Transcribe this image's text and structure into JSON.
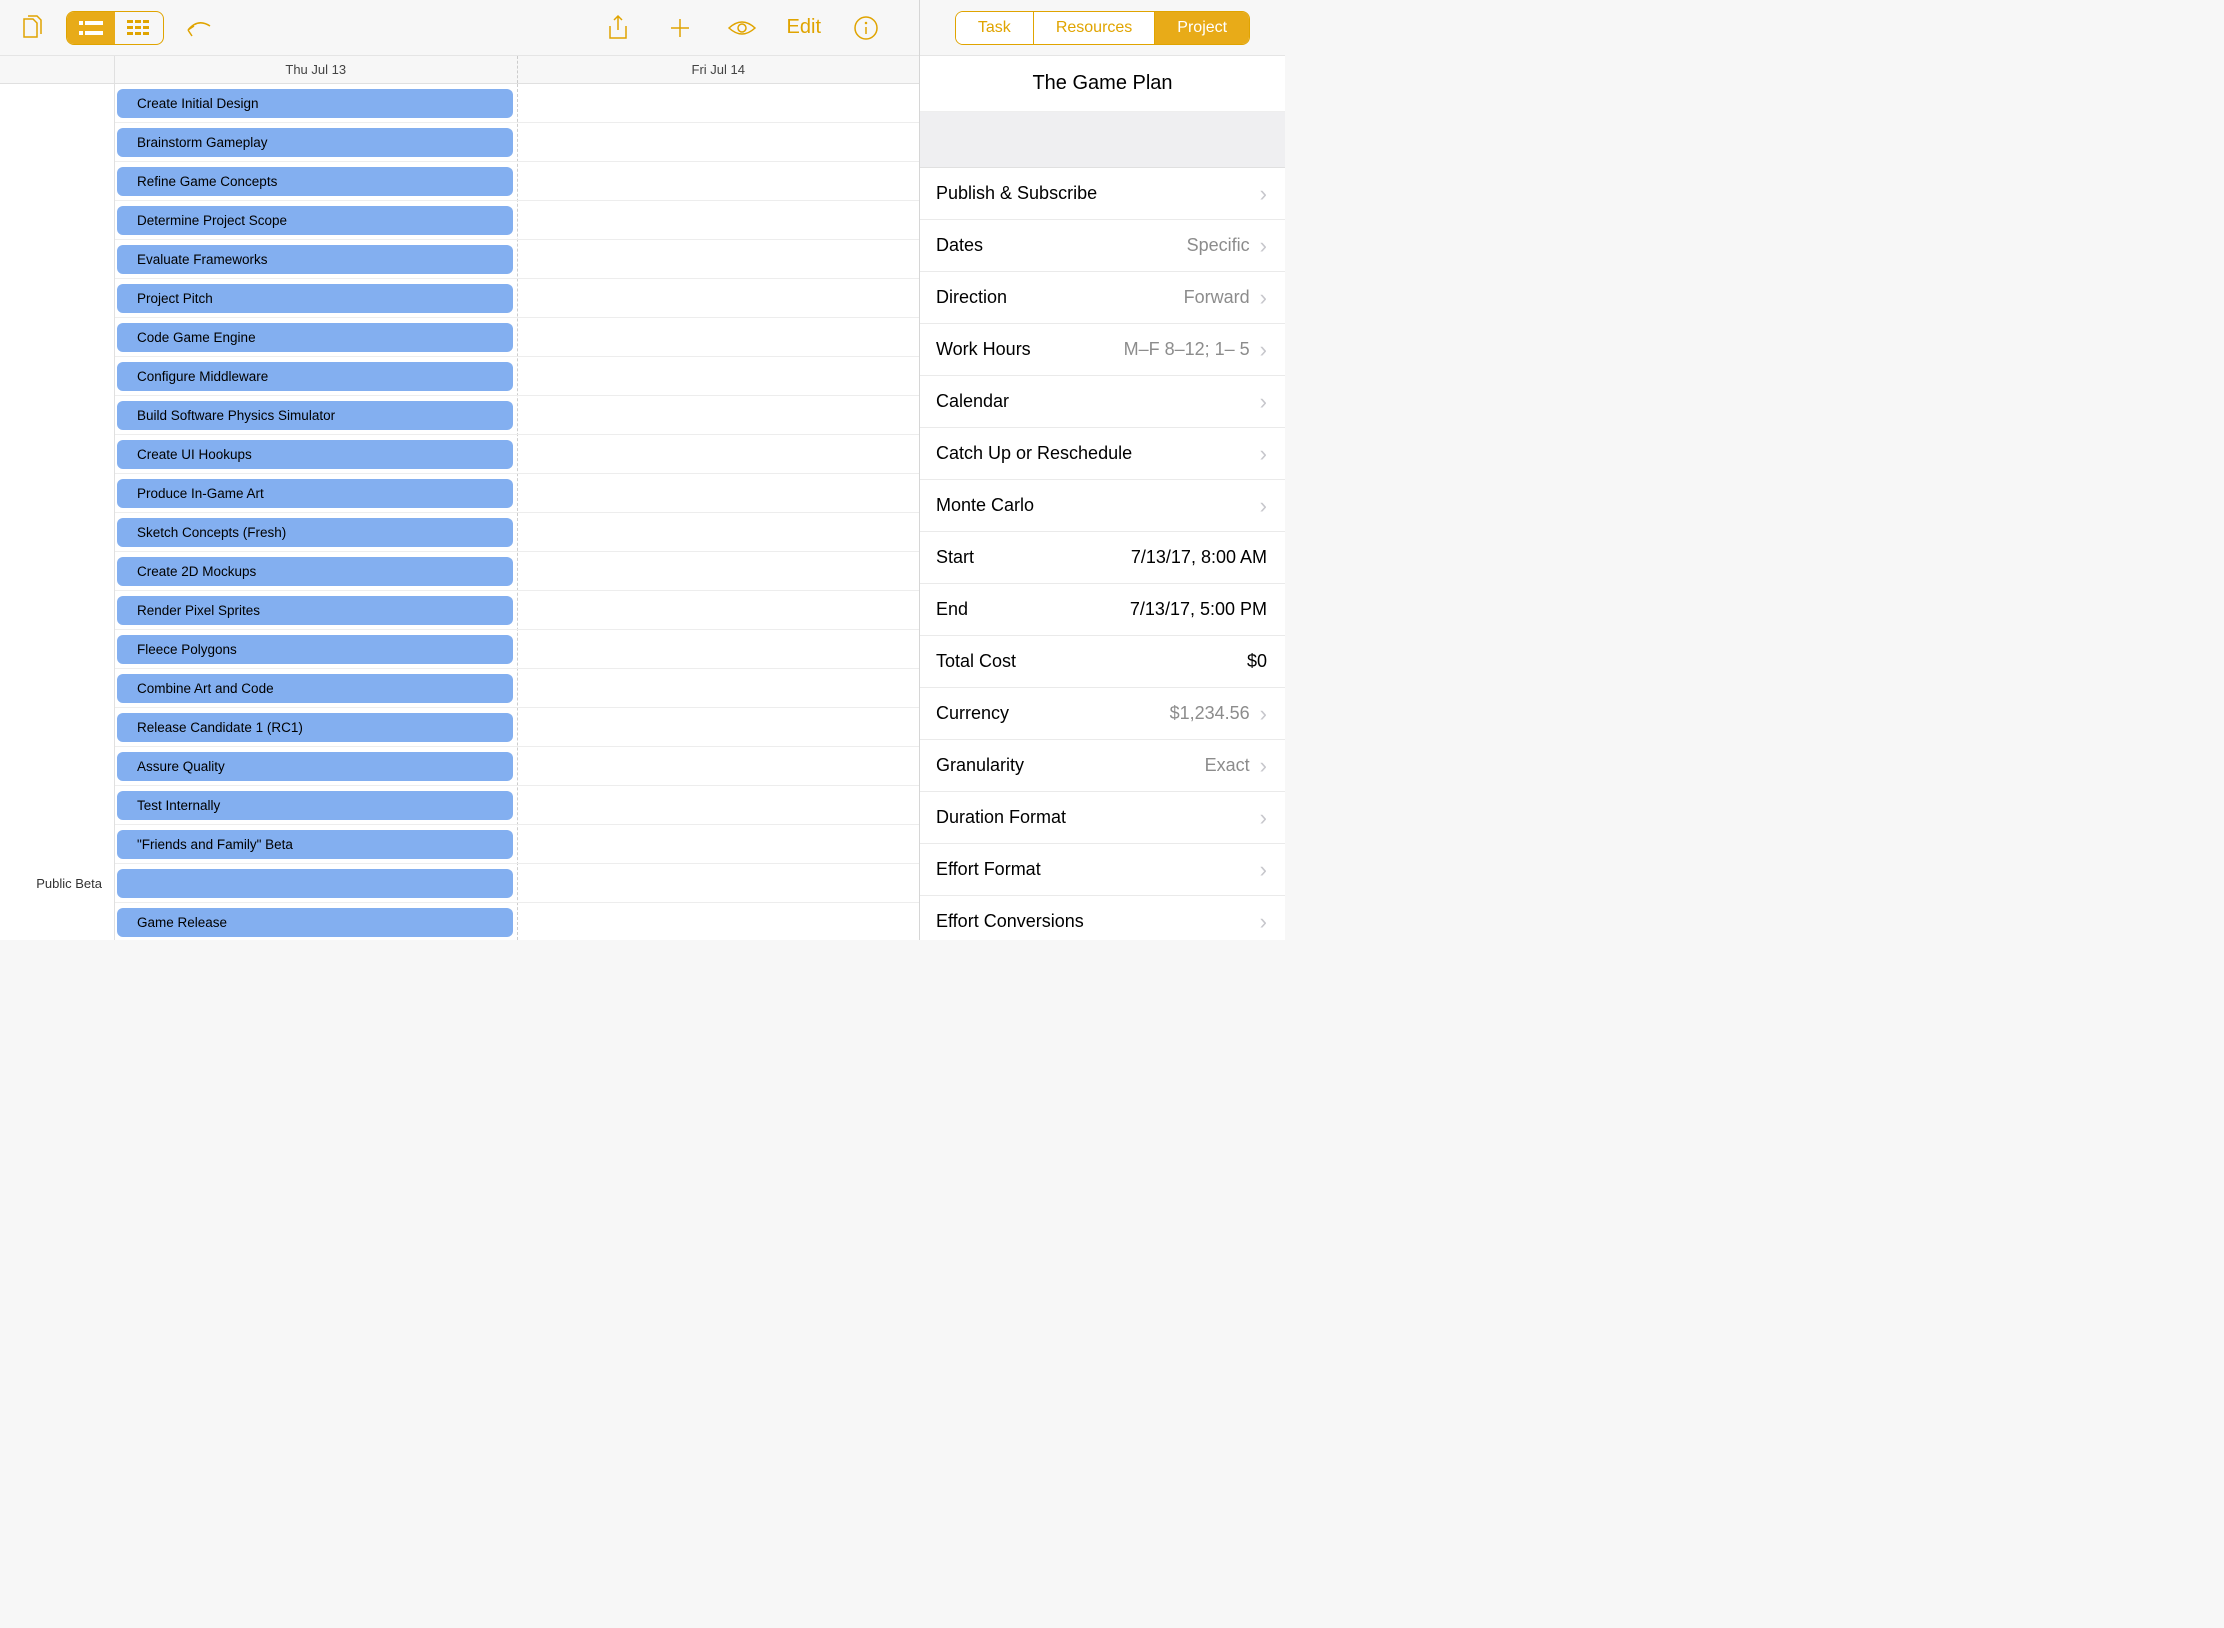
{
  "toolbar": {
    "edit_label": "Edit"
  },
  "timeline": {
    "days": [
      "Thu Jul 13",
      "Fri Jul 14"
    ],
    "row_labels": [
      "",
      "",
      "",
      "",
      "",
      "",
      "",
      "",
      "",
      "",
      "",
      "",
      "",
      "",
      "",
      "",
      "",
      "",
      "",
      "",
      "Public Beta",
      ""
    ],
    "tasks": [
      "Create Initial Design",
      "Brainstorm Gameplay",
      "Refine Game Concepts",
      "Determine Project Scope",
      "Evaluate Frameworks",
      "Project Pitch",
      "Code Game Engine",
      "Configure Middleware",
      "Build Software Physics Simulator",
      "Create UI Hookups",
      "Produce In-Game Art",
      "Sketch Concepts (Fresh)",
      "Create 2D Mockups",
      "Render Pixel Sprites",
      "Fleece Polygons",
      "Combine Art and Code",
      "Release Candidate 1 (RC1)",
      "Assure Quality",
      "Test Internally",
      "\"Friends and Family\" Beta",
      "",
      "Game Release"
    ]
  },
  "inspector": {
    "tabs": {
      "task": "Task",
      "resources": "Resources",
      "project": "Project"
    },
    "title": "The Game Plan",
    "rows": {
      "publish": "Publish & Subscribe",
      "dates": {
        "label": "Dates",
        "value": "Specific"
      },
      "direction": {
        "label": "Direction",
        "value": "Forward"
      },
      "workhours": {
        "label": "Work Hours",
        "value": "M–F  8–12; 1– 5"
      },
      "calendar": "Calendar",
      "catchup": "Catch Up or Reschedule",
      "montecarlo": "Monte Carlo",
      "start": {
        "label": "Start",
        "value": "7/13/17, 8:00 AM"
      },
      "end": {
        "label": "End",
        "value": "7/13/17, 5:00 PM"
      },
      "totalcost": {
        "label": "Total Cost",
        "value": "$0"
      },
      "currency": {
        "label": "Currency",
        "value": "$1,234.56"
      },
      "granularity": {
        "label": "Granularity",
        "value": "Exact"
      },
      "durationformat": "Duration Format",
      "effortformat": "Effort Format",
      "effortconversions": "Effort Conversions"
    }
  }
}
